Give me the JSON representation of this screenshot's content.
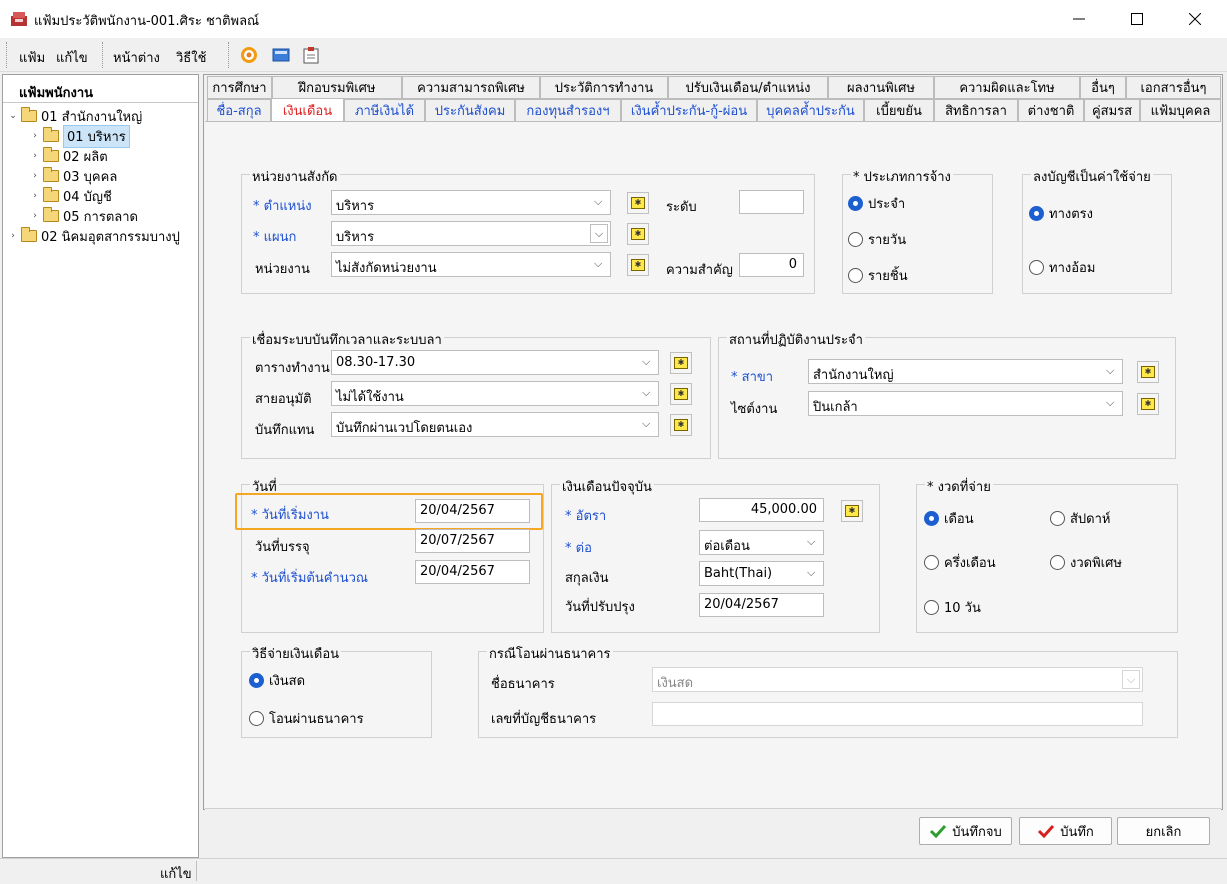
{
  "window": {
    "title": "แฟ้มประวัติพนักงาน-001.ศิระ ชาติพลณ์"
  },
  "menu": {
    "items": [
      "แฟ้ม",
      "แก้ไข",
      "หน้าต่าง",
      "วิธีใช้"
    ]
  },
  "left_panel": {
    "header": "แฟ้มพนักงาน",
    "tree": [
      {
        "label": "01 สำนักงานใหญ่"
      },
      {
        "label": "01 บริหาร"
      },
      {
        "label": "02 ผลิต"
      },
      {
        "label": "03 บุคคล"
      },
      {
        "label": "04 บัญชี"
      },
      {
        "label": "05 การตลาด"
      },
      {
        "label": "02 นิคมอุตสากรรมบางปู"
      }
    ]
  },
  "tabs_row1": [
    "การศึกษา",
    "ฝึกอบรมพิเศษ",
    "ความสามารถพิเศษ",
    "ประวัติการทำงาน",
    "ปรับเงินเดือน/ตำแหน่ง",
    "ผลงานพิเศษ",
    "ความผิดและโทษ",
    "อื่นๆ",
    "เอกสารอื่นๆ"
  ],
  "tabs_row2": [
    "ชื่อ-สกุล",
    "เงินเดือน",
    "ภาษีเงินได้",
    "ประกันสังคม",
    "กองทุนสำรองฯ",
    "เงินค้ำประกัน-กู้-ผ่อน",
    "บุคคลค้ำประกัน",
    "เบี้ยขยัน",
    "สิทธิการลา",
    "ต่างชาติ",
    "คู่สมรส",
    "แฟ้มบุคคล"
  ],
  "unit_group": {
    "title": "หน่วยงานสังกัด",
    "position_label": "* ตำแหน่ง",
    "position_value": "บริหาร",
    "dept_label": "* แผนก",
    "dept_value": "บริหาร",
    "unit_label": "หน่วยงาน",
    "unit_value": "ไม่สังกัดหน่วยงาน",
    "level_label": "ระดับ",
    "level_value": "",
    "importance_label": "ความสำคัญ",
    "importance_value": "0"
  },
  "employ_type": {
    "title": "* ประเภทการจ้าง",
    "options": [
      "ประจำ",
      "รายวัน",
      "รายชิ้น"
    ],
    "selected": 0
  },
  "expense": {
    "title": "ลงบัญชีเป็นค่าใช้จ่าย",
    "options": [
      "ทางตรง",
      "ทางอ้อม"
    ],
    "selected": 0
  },
  "time_group": {
    "title": "เชื่อมระบบบันทึกเวลาและระบบลา",
    "schedule_label": "ตารางทำงาน",
    "schedule_value": "08.30-17.30",
    "approver_label": "สายอนุมัติ",
    "approver_value": "ไม่ได้ใช้งาน",
    "record_label": "บันทึกแทน",
    "record_value": "บันทึกผ่านเวปโดยตนเอง"
  },
  "workplace": {
    "title": "สถานที่ปฏิบัติงานประจำ",
    "branch_label": "* สาขา",
    "branch_value": "สำนักงานใหญ่",
    "site_label": "ไซต์งาน",
    "site_value": "ปินเกล้า"
  },
  "dates": {
    "title": "วันที่",
    "start_label": "* วันที่เริ่มงาน",
    "start_value": "20/04/2567",
    "fulltime_label": "วันที่บรรจุ",
    "fulltime_value": "20/07/2567",
    "calc_label": "* วันที่เริ่มต้นคำนวณ",
    "calc_value": "20/04/2567"
  },
  "salary": {
    "title": "เงินเดือนปัจจุบัน",
    "rate_label": "* อัตรา",
    "rate_value": "45,000.00",
    "per_label": "* ต่อ",
    "per_value": "ต่อเดือน",
    "currency_label": "สกุลเงิน",
    "currency_value": "Baht(Thai)",
    "updated_label": "วันที่ปรับปรุง",
    "updated_value": "20/04/2567"
  },
  "pay_period": {
    "title": "* งวดที่จ่าย",
    "options": [
      "เดือน",
      "สัปดาห์",
      "ครึ่งเดือน",
      "งวดพิเศษ",
      "10 วัน"
    ],
    "selected": 0
  },
  "pay_method": {
    "title": "วิธีจ่ายเงินเดือน",
    "options": [
      "เงินสด",
      "โอนผ่านธนาคาร"
    ],
    "selected": 0
  },
  "bank": {
    "title": "กรณีโอนผ่านธนาคาร",
    "name_label": "ชื่อธนาคาร",
    "name_value": "เงินสด",
    "account_label": "เลขที่บัญชีธนาคาร",
    "account_value": ""
  },
  "buttons": {
    "save_close": "บันทึกจบ",
    "save": "บันทึก",
    "cancel": "ยกเลิก"
  },
  "status": {
    "text": "แก้ไข"
  },
  "colors": {
    "highlight": "#f5a623",
    "link_blue": "#1c4fd0",
    "active_tab": "#e11d1d"
  }
}
